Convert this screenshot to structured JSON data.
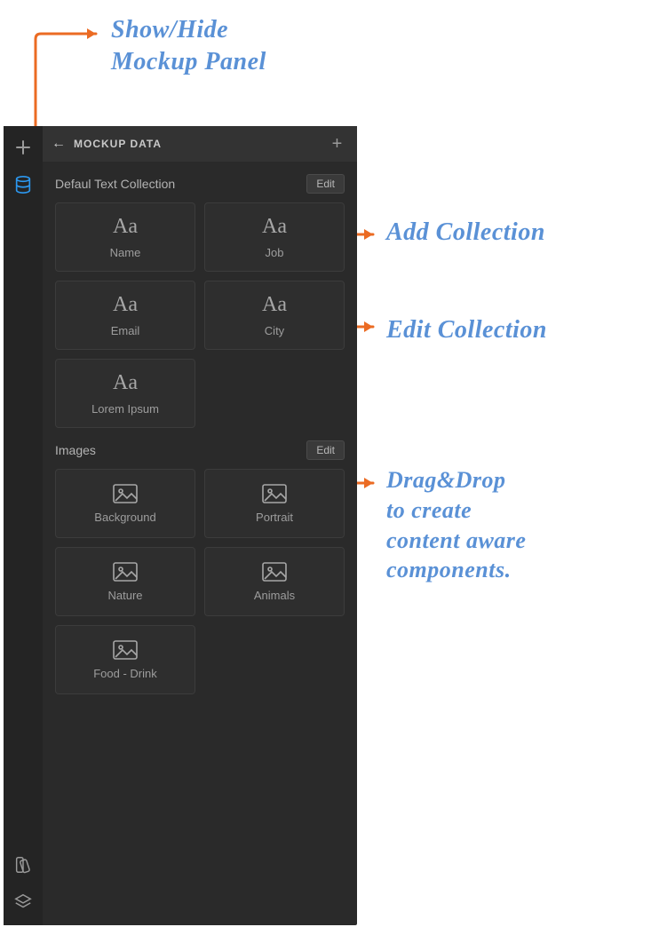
{
  "annotations": {
    "show_hide": "Show/Hide\nMockup Panel",
    "add_collection": "Add Collection",
    "edit_collection": "Edit Collection",
    "drag_drop": "Drag&Drop\nto create\ncontent aware\ncomponents."
  },
  "panel": {
    "title": "MOCKUP DATA",
    "back_glyph": "←",
    "add_glyph": "+"
  },
  "sections": [
    {
      "title": "Defaul Text Collection",
      "edit_label": "Edit",
      "type": "text",
      "tiles": [
        {
          "label": "Name",
          "icon": "Aa"
        },
        {
          "label": "Job",
          "icon": "Aa"
        },
        {
          "label": "Email",
          "icon": "Aa"
        },
        {
          "label": "City",
          "icon": "Aa"
        },
        {
          "label": "Lorem Ipsum",
          "icon": "Aa"
        }
      ]
    },
    {
      "title": "Images",
      "edit_label": "Edit",
      "type": "image",
      "tiles": [
        {
          "label": "Background"
        },
        {
          "label": "Portrait"
        },
        {
          "label": "Nature"
        },
        {
          "label": "Animals"
        },
        {
          "label": "Food - Drink"
        }
      ]
    }
  ]
}
